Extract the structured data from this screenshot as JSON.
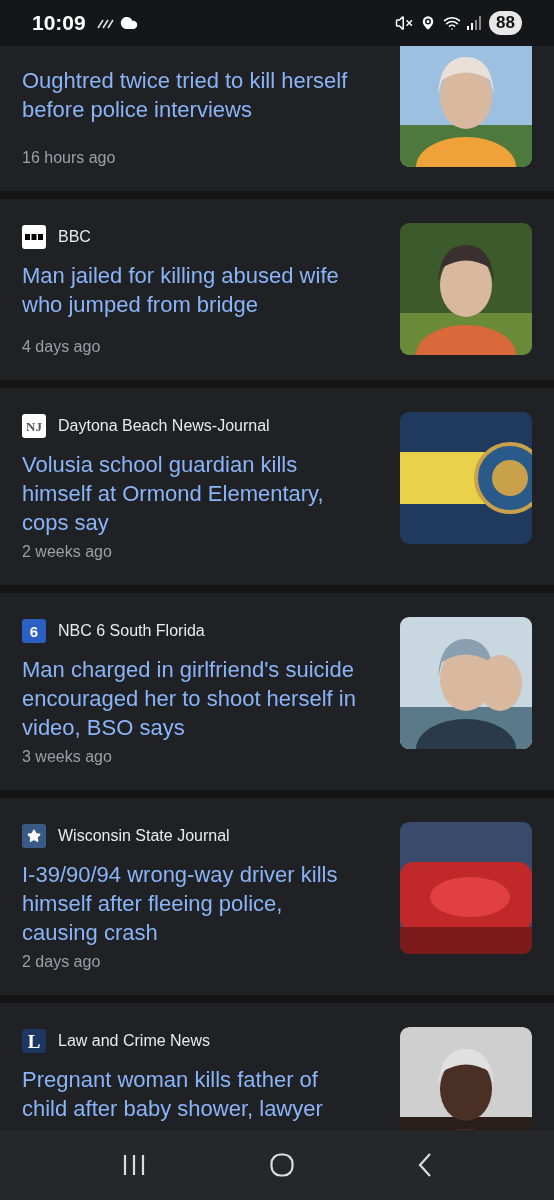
{
  "status_bar": {
    "time": "10:09",
    "battery": "88"
  },
  "articles": [
    {
      "headline": "Oughtred twice tried to kill herself before police interviews",
      "time": "16 hours ago"
    },
    {
      "source": "BBC",
      "logo": {
        "kind": "bbc"
      },
      "headline": "Man jailed for killing abused wife who jumped from bridge",
      "time": "4 days ago"
    },
    {
      "source": "Daytona Beach News-Journal",
      "logo": {
        "kind": "nj",
        "text": "NJ"
      },
      "headline": "Volusia school guardian kills himself at Ormond Elementary, cops say",
      "time": "2 weeks ago"
    },
    {
      "source": "NBC 6 South Florida",
      "logo": {
        "kind": "nbc",
        "text": "6"
      },
      "headline": "Man charged in girlfriend's suicide encouraged her to shoot herself in video, BSO says",
      "time": "3 weeks ago"
    },
    {
      "source": "Wisconsin State Journal",
      "logo": {
        "kind": "star"
      },
      "headline": "I-39/90/94 wrong-way driver kills himself after fleeing police, causing crash",
      "time": "2 days ago"
    },
    {
      "source": "Law and Crime News",
      "logo": {
        "kind": "letter",
        "text": "L"
      },
      "headline": "Pregnant woman kills father of child after baby shower, lawyer"
    }
  ]
}
